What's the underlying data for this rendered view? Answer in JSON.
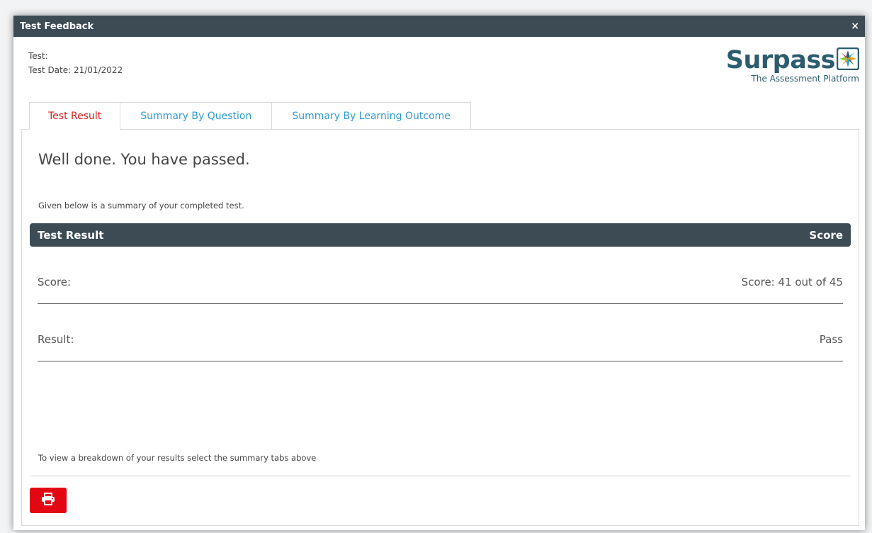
{
  "dialog": {
    "title": "Test Feedback",
    "close_label": "×"
  },
  "meta": {
    "test_label": "Test:",
    "test_date_label": "Test Date: 21/01/2022"
  },
  "logo": {
    "brand": "Surpass",
    "tagline": "The Assessment Platform"
  },
  "tabs": [
    {
      "label": "Test Result",
      "active": true
    },
    {
      "label": "Summary By Question",
      "active": false
    },
    {
      "label": "Summary By Learning Outcome",
      "active": false
    }
  ],
  "panel": {
    "headline": "Well done. You have passed.",
    "subtext": "Given below is a summary of your completed test.",
    "table_header": {
      "left": "Test Result",
      "right": "Score"
    },
    "rows": [
      {
        "label": "Score:",
        "value": "Score: 41 out of 45"
      },
      {
        "label": "Result:",
        "value": "Pass"
      }
    ],
    "footer_note": "To view a breakdown of your results select the summary tabs above"
  },
  "colors": {
    "header_bg": "#3c4b54",
    "active_tab": "#e02020",
    "inactive_tab": "#2f9bd3",
    "print_button": "#e30613",
    "brand": "#2d5c6f"
  },
  "icons": {
    "close": "close-icon",
    "print": "printer-icon",
    "logo_mark": "surpass-logo-mark-icon"
  }
}
